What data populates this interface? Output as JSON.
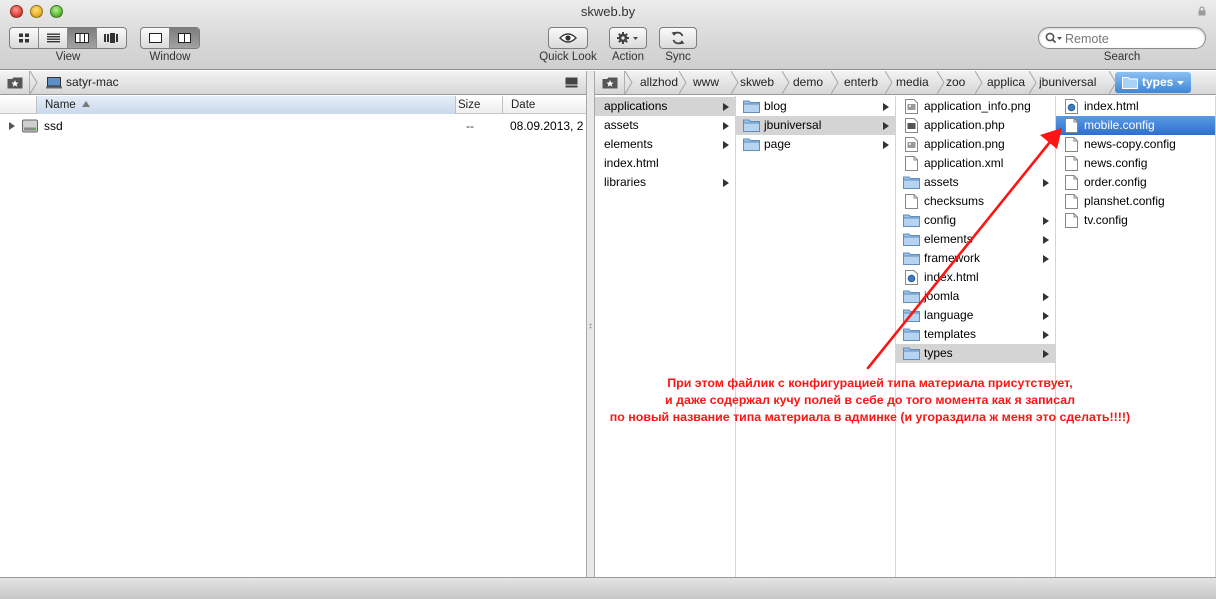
{
  "window": {
    "title": "skweb.by"
  },
  "toolbar": {
    "view_label": "View",
    "window_label": "Window",
    "quicklook_label": "Quick Look",
    "action_label": "Action",
    "sync_label": "Sync",
    "search_label": "Search",
    "search_placeholder": "Remote"
  },
  "left_pane": {
    "path": "satyr-mac",
    "columns": {
      "name": "Name",
      "size": "Size",
      "date": "Date"
    },
    "rows": [
      {
        "name": "ssd",
        "size": "--",
        "date": "08.09.2013, 2"
      }
    ]
  },
  "right_pane": {
    "breadcrumbs": [
      "allzhod",
      "www",
      "skweb",
      "demo",
      "enterb",
      "media",
      "zoo",
      "applica",
      "jbuniversal",
      "types"
    ],
    "columns": [
      {
        "items": [
          {
            "label": "applications",
            "type": "folder-plain",
            "has_children": true,
            "selected": true
          },
          {
            "label": "assets",
            "type": "folder-plain",
            "has_children": true
          },
          {
            "label": "elements",
            "type": "folder-plain",
            "has_children": true
          },
          {
            "label": "index.html",
            "type": "file-plain",
            "has_children": false
          },
          {
            "label": "libraries",
            "type": "folder-plain",
            "has_children": true
          }
        ]
      },
      {
        "items": [
          {
            "label": "blog",
            "type": "folder",
            "has_children": true
          },
          {
            "label": "jbuniversal",
            "type": "folder",
            "has_children": true,
            "selected": true
          },
          {
            "label": "page",
            "type": "folder",
            "has_children": true
          }
        ]
      },
      {
        "items": [
          {
            "label": "application_info.png",
            "type": "image",
            "has_children": false
          },
          {
            "label": "application.php",
            "type": "php",
            "has_children": false
          },
          {
            "label": "application.png",
            "type": "image",
            "has_children": false
          },
          {
            "label": "application.xml",
            "type": "file",
            "has_children": false
          },
          {
            "label": "assets",
            "type": "folder",
            "has_children": true
          },
          {
            "label": "checksums",
            "type": "file",
            "has_children": false
          },
          {
            "label": "config",
            "type": "folder",
            "has_children": true
          },
          {
            "label": "elements",
            "type": "folder",
            "has_children": true
          },
          {
            "label": "framework",
            "type": "folder",
            "has_children": true
          },
          {
            "label": "index.html",
            "type": "html",
            "has_children": false
          },
          {
            "label": "joomla",
            "type": "folder",
            "has_children": true
          },
          {
            "label": "language",
            "type": "folder",
            "has_children": true
          },
          {
            "label": "templates",
            "type": "folder",
            "has_children": true
          },
          {
            "label": "types",
            "type": "folder",
            "has_children": true,
            "selected": true
          }
        ]
      },
      {
        "items": [
          {
            "label": "index.html",
            "type": "html",
            "has_children": false
          },
          {
            "label": "mobile.config",
            "type": "file",
            "has_children": false,
            "selected_active": true
          },
          {
            "label": "news-copy.config",
            "type": "file",
            "has_children": false
          },
          {
            "label": "news.config",
            "type": "file",
            "has_children": false
          },
          {
            "label": "order.config",
            "type": "file",
            "has_children": false
          },
          {
            "label": "planshet.config",
            "type": "file",
            "has_children": false
          },
          {
            "label": "tv.config",
            "type": "file",
            "has_children": false
          }
        ]
      }
    ]
  },
  "annotation": {
    "lines": [
      "При этом файлик с конфигурацией типа материала присутствует,",
      "и даже содержал кучу полей в себе до того момента как я записал",
      "по новый название типа материала в админке (и угораздила ж меня это сделать!!!!)"
    ],
    "color": "#ff1414"
  },
  "colors": {
    "selection_blue": "#3d86d6",
    "selection_grey": "#d4d4d4"
  }
}
